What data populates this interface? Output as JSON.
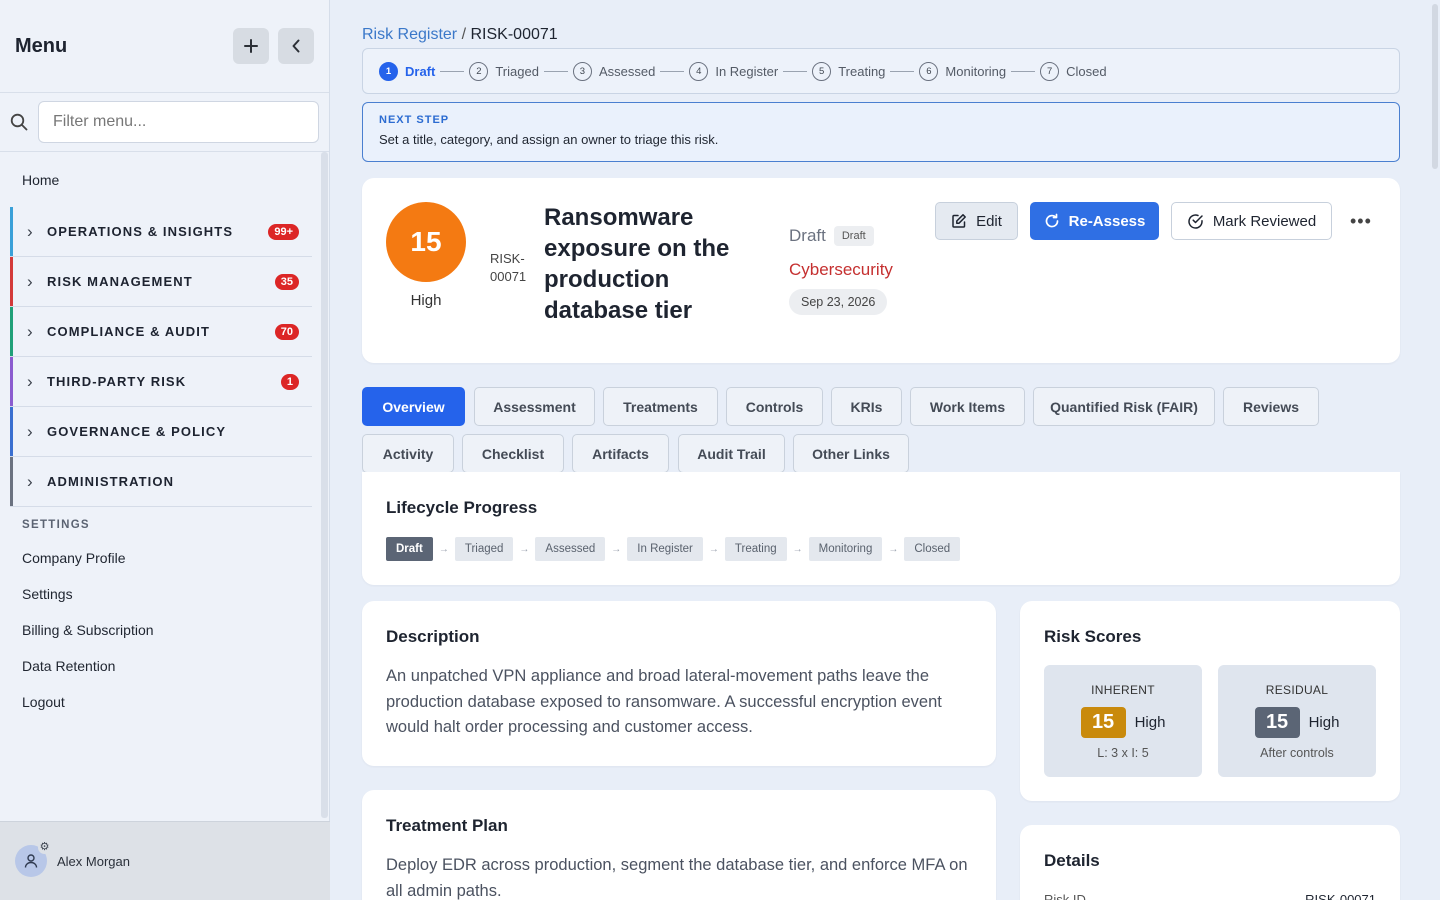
{
  "sidebar": {
    "title": "Menu",
    "filter_placeholder": "Filter menu...",
    "home": "Home",
    "groups": [
      {
        "label": "OPERATIONS & INSIGHTS",
        "count": "99+",
        "color": "#3aa0d8"
      },
      {
        "label": "RISK MANAGEMENT",
        "count": "35",
        "color": "#d33a3a"
      },
      {
        "label": "COMPLIANCE & AUDIT",
        "count": "70",
        "color": "#20a078"
      },
      {
        "label": "THIRD-PARTY RISK",
        "count": "1",
        "color": "#8b5ccf"
      },
      {
        "label": "GOVERNANCE & POLICY",
        "count": "",
        "color": "#3a6fd0"
      },
      {
        "label": "ADMINISTRATION",
        "count": "",
        "color": "#6b7280"
      }
    ],
    "settings_heading": "SETTINGS",
    "settings_items": [
      "Company Profile",
      "Settings",
      "Billing & Subscription",
      "Data Retention",
      "Logout"
    ],
    "user": "Alex Morgan"
  },
  "breadcrumb": {
    "parent": "Risk Register",
    "separator": "/",
    "current": "RISK-00071"
  },
  "stepper": {
    "steps": [
      {
        "num": "1",
        "label": "Draft"
      },
      {
        "num": "2",
        "label": "Triaged"
      },
      {
        "num": "3",
        "label": "Assessed"
      },
      {
        "num": "4",
        "label": "In Register"
      },
      {
        "num": "5",
        "label": "Treating"
      },
      {
        "num": "6",
        "label": "Monitoring"
      },
      {
        "num": "7",
        "label": "Closed"
      }
    ],
    "active_index": 0
  },
  "next_step": {
    "heading": "NEXT STEP",
    "text": "Set a title, category, and assign an owner to triage this risk."
  },
  "risk": {
    "score": "15",
    "level": "High",
    "id": "RISK-00071",
    "title": "Ransomware exposure on the production database tier",
    "status": "Draft",
    "status_badge": "Draft",
    "category": "Cybersecurity",
    "date": "Sep 23, 2026"
  },
  "actions": {
    "edit": "Edit",
    "reassess": "Re-Assess",
    "mark_reviewed": "Mark Reviewed",
    "more": "•••"
  },
  "tabs": [
    "Overview",
    "Assessment",
    "Treatments",
    "Controls",
    "KRIs",
    "Work Items",
    "Quantified Risk (FAIR)",
    "Reviews",
    "Activity",
    "Checklist",
    "Artifacts",
    "Audit Trail",
    "Other Links"
  ],
  "lifecycle": {
    "title": "Lifecycle Progress",
    "stages": [
      "Draft",
      "Triaged",
      "Assessed",
      "In Register",
      "Treating",
      "Monitoring",
      "Closed"
    ],
    "arrow": "→"
  },
  "description": {
    "title": "Description",
    "text": "An unpatched VPN appliance and broad lateral-movement paths leave the production database exposed to ransomware. A successful encryption event would halt order processing and customer access."
  },
  "treatment": {
    "title": "Treatment Plan",
    "text": "Deploy EDR across production, segment the database tier, and enforce MFA on all admin paths."
  },
  "scores": {
    "title": "Risk Scores",
    "inherent": {
      "label": "INHERENT",
      "score": "15",
      "level": "High",
      "sub": "L: 3 x I: 5",
      "color": "#c98a0c"
    },
    "residual": {
      "label": "RESIDUAL",
      "score": "15",
      "level": "High",
      "sub": "After controls",
      "color": "#5b6575"
    }
  },
  "details": {
    "title": "Details",
    "risk_id_label": "Risk ID",
    "risk_id_value": "RISK-00071"
  },
  "colors": {
    "accent": "#2563eb",
    "score_orange": "#f47a12",
    "category_red": "#c53030"
  }
}
